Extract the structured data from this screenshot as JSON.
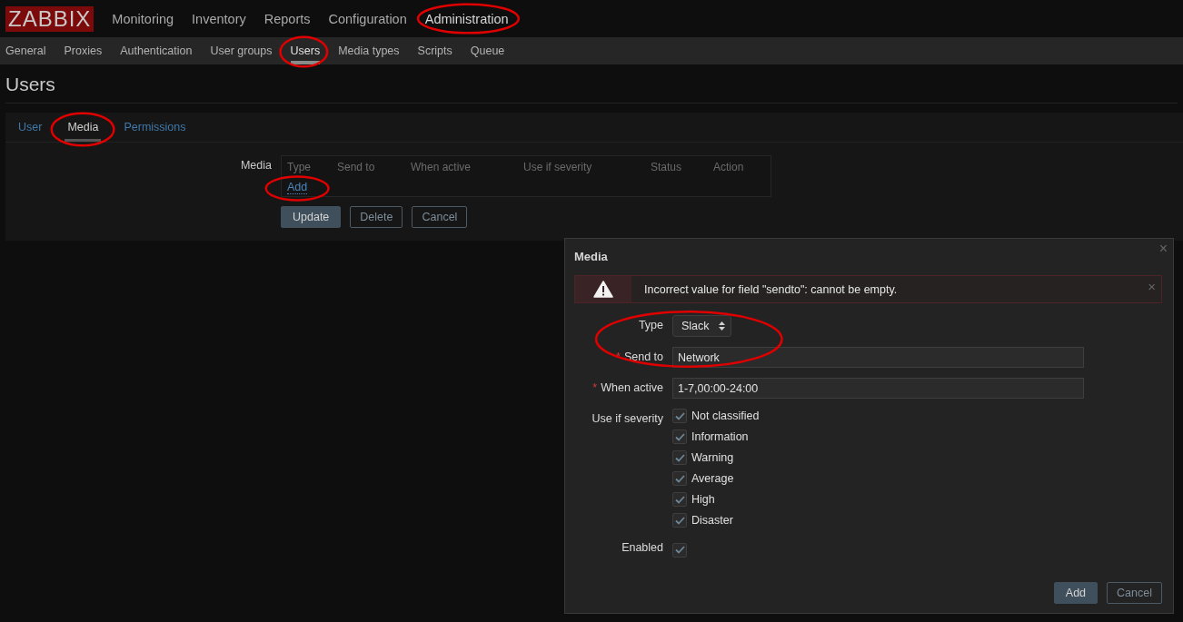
{
  "logo": "ZABBIX",
  "main_menu": [
    {
      "label": "Monitoring",
      "selected": false,
      "circled": false
    },
    {
      "label": "Inventory",
      "selected": false,
      "circled": false
    },
    {
      "label": "Reports",
      "selected": false,
      "circled": false
    },
    {
      "label": "Configuration",
      "selected": false,
      "circled": false
    },
    {
      "label": "Administration",
      "selected": true,
      "circled": true
    }
  ],
  "sub_menu": [
    {
      "label": "General",
      "selected": false,
      "circled": false
    },
    {
      "label": "Proxies",
      "selected": false,
      "circled": false
    },
    {
      "label": "Authentication",
      "selected": false,
      "circled": false
    },
    {
      "label": "User groups",
      "selected": false,
      "circled": false
    },
    {
      "label": "Users",
      "selected": true,
      "circled": true
    },
    {
      "label": "Media types",
      "selected": false,
      "circled": false
    },
    {
      "label": "Scripts",
      "selected": false,
      "circled": false
    },
    {
      "label": "Queue",
      "selected": false,
      "circled": false
    }
  ],
  "page_title": "Users",
  "tabs": [
    {
      "label": "User",
      "selected": false,
      "circled": false
    },
    {
      "label": "Media",
      "selected": true,
      "circled": true
    },
    {
      "label": "Permissions",
      "selected": false,
      "circled": false
    }
  ],
  "media_form": {
    "label": "Media",
    "columns": [
      "Type",
      "Send to",
      "When active",
      "Use if severity",
      "Status",
      "Action"
    ],
    "add_link": {
      "label": "Add",
      "circled": true
    },
    "buttons": [
      {
        "label": "Update",
        "kind": "primary"
      },
      {
        "label": "Delete",
        "kind": "secondary"
      },
      {
        "label": "Cancel",
        "kind": "secondary"
      }
    ]
  },
  "dialog": {
    "title": "Media",
    "close": "×",
    "required_mark": "*",
    "error": {
      "message": "Incorrect value for field \"sendto\": cannot be empty.",
      "close": "×"
    },
    "fields": [
      {
        "kind": "select",
        "label": "Type",
        "required": false,
        "value": "Slack",
        "circled": true
      },
      {
        "kind": "text",
        "label": "Send to",
        "required": true,
        "value": "Network"
      },
      {
        "kind": "text",
        "label": "When active",
        "required": true,
        "value": "1-7,00:00-24:00"
      },
      {
        "kind": "checklist",
        "label": "Use if severity",
        "required": false,
        "options": [
          {
            "label": "Not classified",
            "checked": true
          },
          {
            "label": "Information",
            "checked": true
          },
          {
            "label": "Warning",
            "checked": true
          },
          {
            "label": "Average",
            "checked": true
          },
          {
            "label": "High",
            "checked": true
          },
          {
            "label": "Disaster",
            "checked": true
          }
        ]
      },
      {
        "kind": "checkbox",
        "label": "Enabled",
        "required": false,
        "checked": true
      }
    ],
    "buttons": [
      {
        "label": "Add",
        "kind": "primary"
      },
      {
        "label": "Cancel",
        "kind": "secondary"
      }
    ]
  }
}
